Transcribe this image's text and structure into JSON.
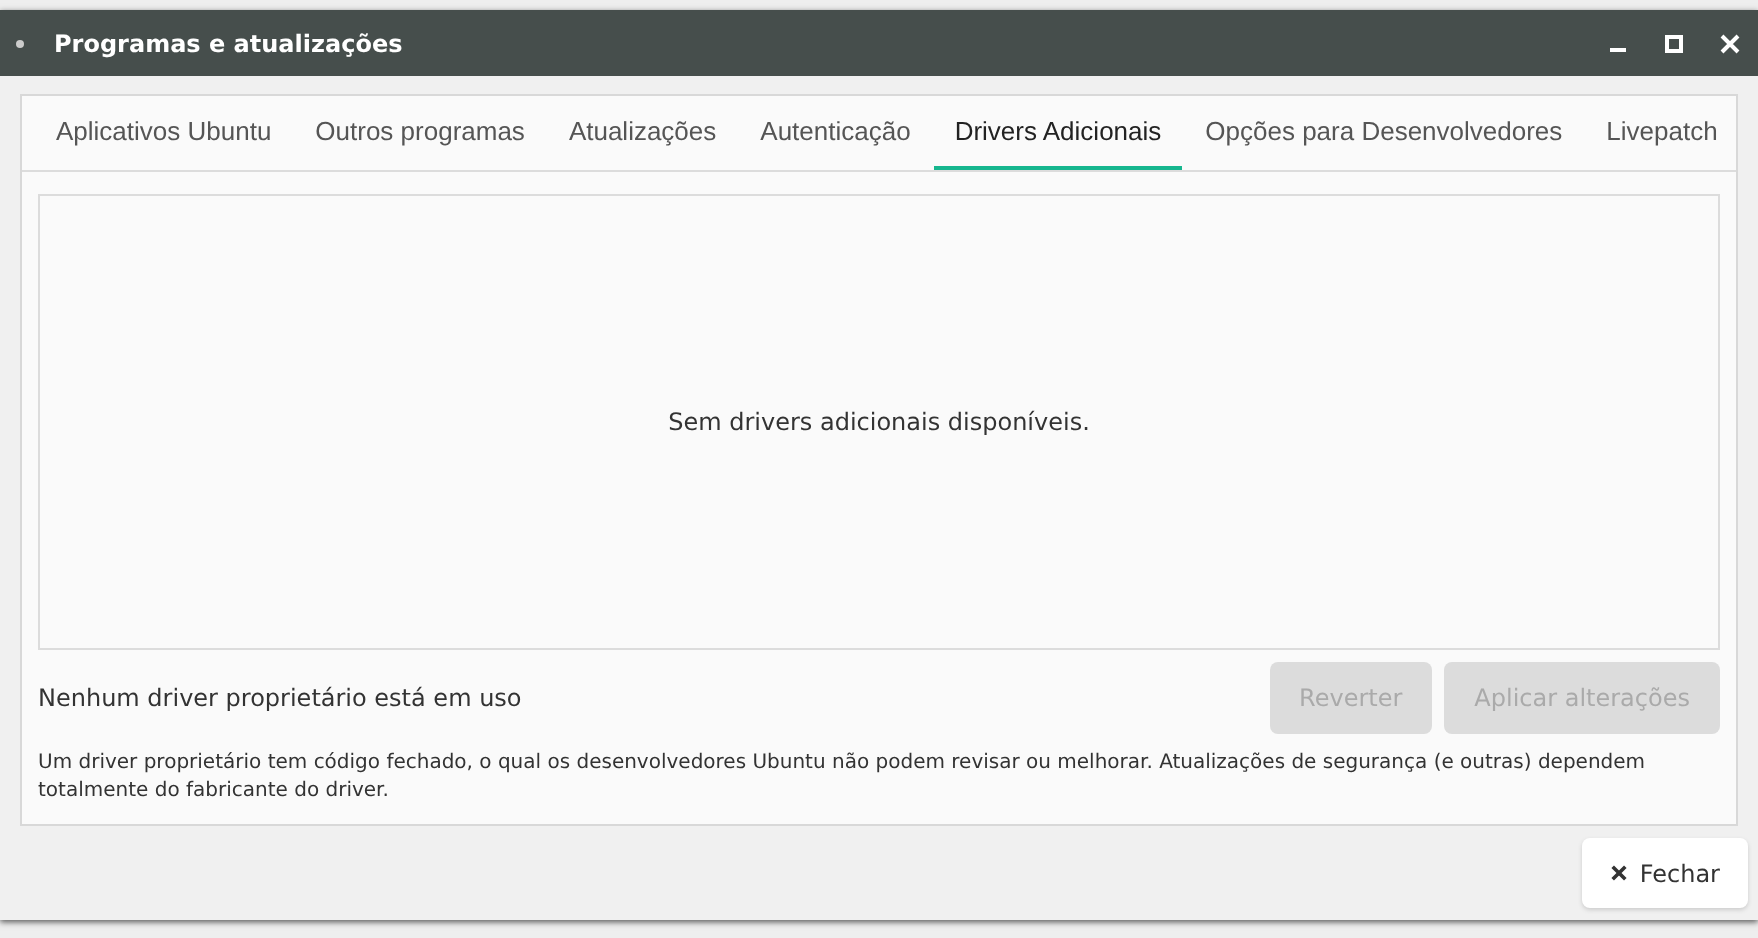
{
  "window": {
    "title": "Programas e atualizações"
  },
  "tabs": [
    {
      "label": "Aplicativos Ubuntu",
      "selected": false
    },
    {
      "label": "Outros programas",
      "selected": false
    },
    {
      "label": "Atualizações",
      "selected": false
    },
    {
      "label": "Autenticação",
      "selected": false
    },
    {
      "label": "Drivers Adicionais",
      "selected": true
    },
    {
      "label": "Opções para Desenvolvedores",
      "selected": false
    },
    {
      "label": "Livepatch",
      "selected": false
    }
  ],
  "drivers_list": {
    "empty_message": "Sem drivers adicionais disponíveis."
  },
  "status": "Nenhum driver proprietário está em uso",
  "buttons": [
    {
      "label": "Reverter",
      "disabled": true
    },
    {
      "label": "Aplicar alterações",
      "disabled": true
    }
  ],
  "note": "Um driver proprietário tem código fechado, o qual os desenvolvedores Ubuntu não podem revisar ou melhorar. Atualizações de segurança (e outras) dependem totalmente do fabricante do driver.",
  "close_button": {
    "label": "Fechar"
  }
}
